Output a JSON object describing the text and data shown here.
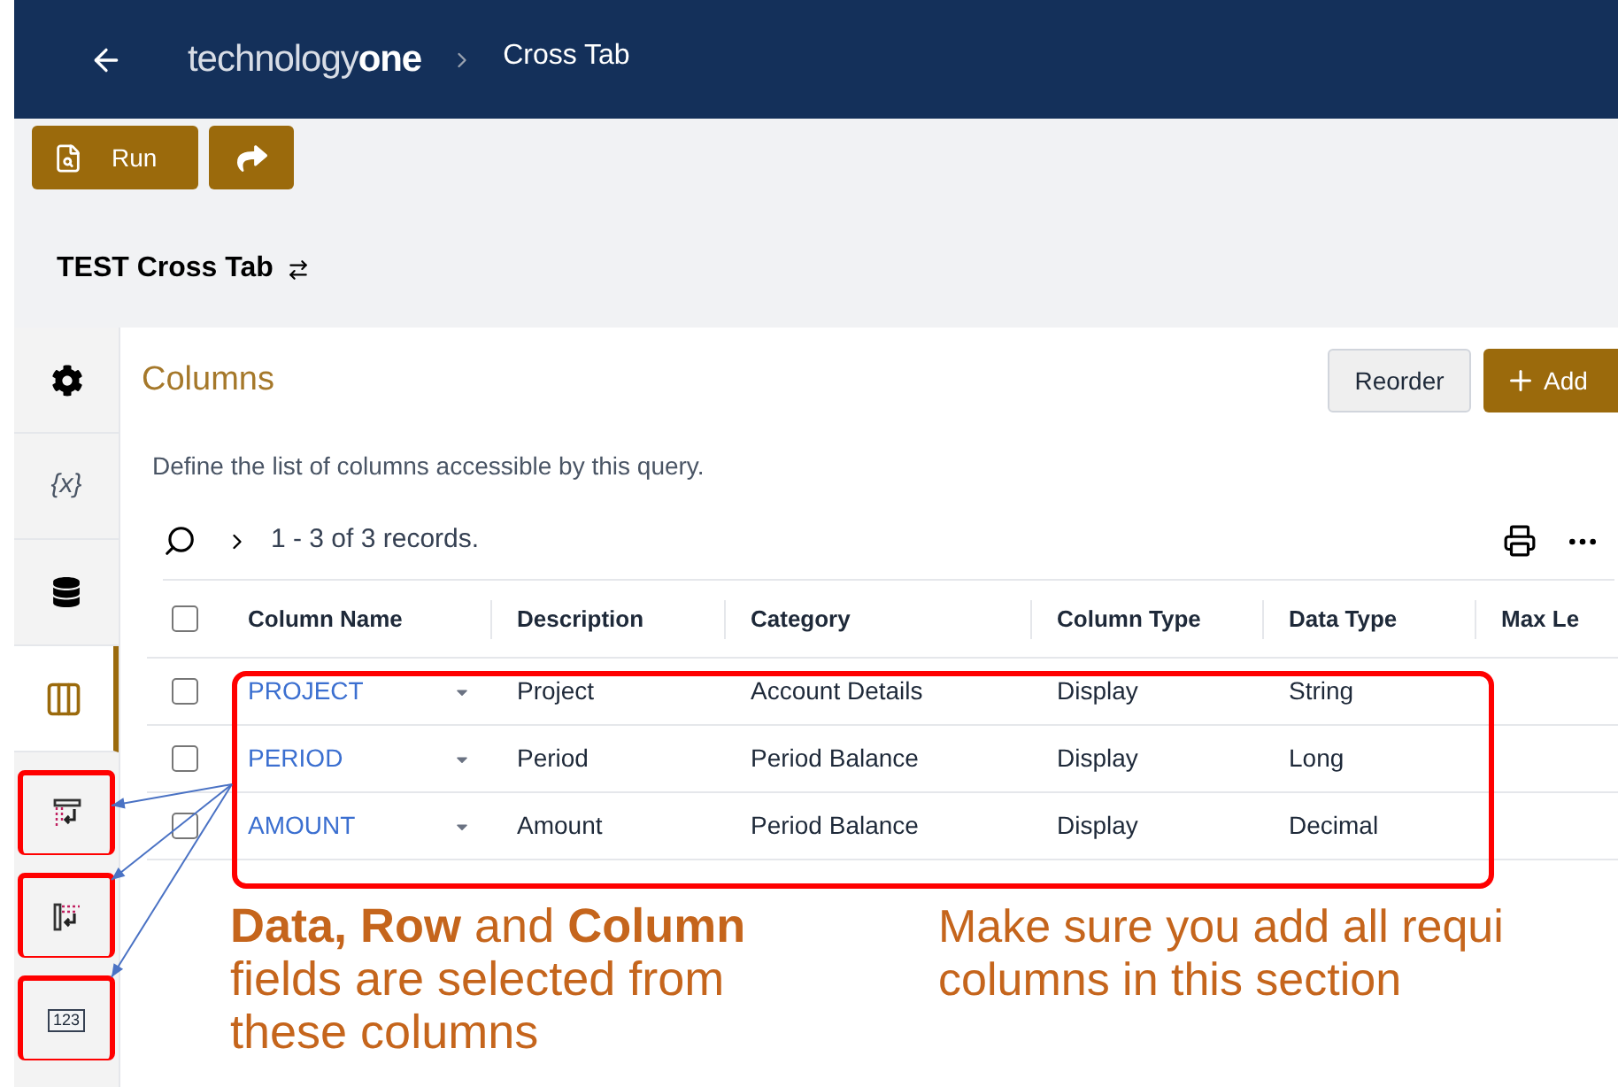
{
  "header": {
    "logo_light": "technology",
    "logo_bold": "one",
    "breadcrumb": "Cross Tab"
  },
  "toolbar": {
    "run_label": "Run"
  },
  "title": "TEST Cross Tab",
  "sidebar": {
    "items": [
      {
        "kind": "gear",
        "selected": false,
        "annotated": false
      },
      {
        "kind": "variable",
        "glyph": "{x}",
        "selected": false,
        "annotated": false
      },
      {
        "kind": "database",
        "selected": false,
        "annotated": false
      },
      {
        "kind": "columns",
        "selected": true,
        "annotated": false
      },
      {
        "kind": "row-field",
        "selected": false,
        "annotated": true
      },
      {
        "kind": "column-field",
        "selected": false,
        "annotated": true
      },
      {
        "kind": "number-field",
        "glyph": "123",
        "selected": false,
        "annotated": true
      }
    ]
  },
  "panel": {
    "heading": "Columns",
    "reorder": "Reorder",
    "add": "Add",
    "description": "Define the list of columns accessible by this query.",
    "records": "1 - 3 of 3 records."
  },
  "table": {
    "header_checked": false,
    "columns": [
      "Column Name",
      "Description",
      "Category",
      "Column Type",
      "Data Type",
      "Max Le"
    ],
    "rows": [
      {
        "checked": false,
        "name": "PROJECT",
        "description": "Project",
        "category": "Account Details",
        "column_type": "Display",
        "data_type": "String"
      },
      {
        "checked": false,
        "name": "PERIOD",
        "description": "Period",
        "category": "Period Balance",
        "column_type": "Display",
        "data_type": "Long"
      },
      {
        "checked": false,
        "name": "AMOUNT",
        "description": "Amount",
        "category": "Period Balance",
        "column_type": "Display",
        "data_type": "Decimal"
      }
    ]
  },
  "annotations": {
    "left": [
      "**Data, Row** and **Column**",
      "fields are selected from",
      "these columns"
    ],
    "right": [
      "Make sure you add all requi",
      "columns in this section"
    ]
  }
}
